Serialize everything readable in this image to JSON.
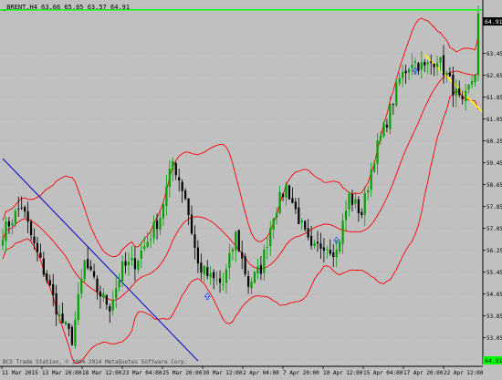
{
  "window": {
    "symbol_header": "_BRENT,H4  63.66 65.05 63.57 64.91",
    "footer_text": "BCS Trade Station, © 2004-2014 MetaQuotes Software Corp.",
    "current_price_label": "64.91",
    "last_price_label": "64.91"
  },
  "colors": {
    "background": "#c0c0c0",
    "grid": "#a8a8a8",
    "bull_candle": "#00a000",
    "bear_candle": "#000000",
    "bollinger": "#ff0000",
    "trendline_blue": "#0000cc",
    "trendline_yellow": "#ffff00",
    "level_line": "#00ff00",
    "arrow": "#4060ff"
  },
  "chart_data": {
    "type": "candlestick",
    "timeframe": "H4",
    "instrument": "_BRENT",
    "ohlc_header": {
      "open": 63.66,
      "high": 65.05,
      "low": 63.57,
      "close": 64.91
    },
    "y_range": [
      52.0,
      65.4
    ],
    "y_ticks": [
      "64.91",
      "63.45",
      "62.65",
      "61.85",
      "61.05",
      "60.25",
      "59.45",
      "58.65",
      "57.85",
      "57.05",
      "56.25",
      "55.45",
      "54.65",
      "53.85",
      "53.05",
      "52.25"
    ],
    "x_ticks": [
      "11 Mar 2015",
      "13 Mar 20:00",
      "18 Mar 12:00",
      "23 Mar 04:00",
      "25 Mar 20:00",
      "30 Mar 12:00",
      "2 Apr 04:00",
      "7 Apr 20:00",
      "10 Apr 12:00",
      "15 Apr 04:00",
      "17 Apr 20:00",
      "22 Apr 12:00"
    ],
    "horizontal_level": 64.91,
    "indicators": [
      "Bollinger Bands (upper, middle, lower)"
    ],
    "anchors": [
      [
        0,
        56.9
      ],
      [
        6,
        57.9
      ],
      [
        10,
        56.4
      ],
      [
        14,
        55.2
      ],
      [
        18,
        53.8
      ],
      [
        22,
        53.0
      ],
      [
        26,
        55.8
      ],
      [
        30,
        54.8
      ],
      [
        34,
        54.2
      ],
      [
        38,
        55.6
      ],
      [
        42,
        55.8
      ],
      [
        46,
        56.6
      ],
      [
        50,
        57.5
      ],
      [
        54,
        59.5
      ],
      [
        58,
        58.2
      ],
      [
        62,
        55.7
      ],
      [
        66,
        55.2
      ],
      [
        70,
        55.0
      ],
      [
        74,
        56.8
      ],
      [
        78,
        55.0
      ],
      [
        82,
        55.6
      ],
      [
        86,
        57.6
      ],
      [
        90,
        58.6
      ],
      [
        94,
        57.4
      ],
      [
        98,
        56.2
      ],
      [
        102,
        56.5
      ],
      [
        106,
        56.2
      ],
      [
        110,
        58.2
      ],
      [
        114,
        57.6
      ],
      [
        118,
        59.7
      ],
      [
        122,
        61.0
      ],
      [
        126,
        62.5
      ],
      [
        130,
        63.2
      ],
      [
        134,
        62.9
      ],
      [
        138,
        63.3
      ],
      [
        142,
        62.4
      ],
      [
        146,
        61.5
      ],
      [
        150,
        62.8
      ],
      [
        151,
        64.9
      ]
    ],
    "arrows": [
      {
        "type": "buy",
        "bar": 65,
        "price": 54.55
      },
      {
        "type": "buy",
        "bar": 106,
        "price": 56.6
      },
      {
        "type": "buy",
        "bar": 131,
        "price": 62.8
      }
    ],
    "trendlines": [
      {
        "color": "blue",
        "from": {
          "bar": 0,
          "price": 59.6
        },
        "to": {
          "bar": 62,
          "price": 52.2
        }
      },
      {
        "color": "yellow",
        "from": {
          "bar": 134,
          "price": 63.4
        },
        "to": {
          "bar": 155,
          "price": 61.0
        }
      }
    ]
  }
}
